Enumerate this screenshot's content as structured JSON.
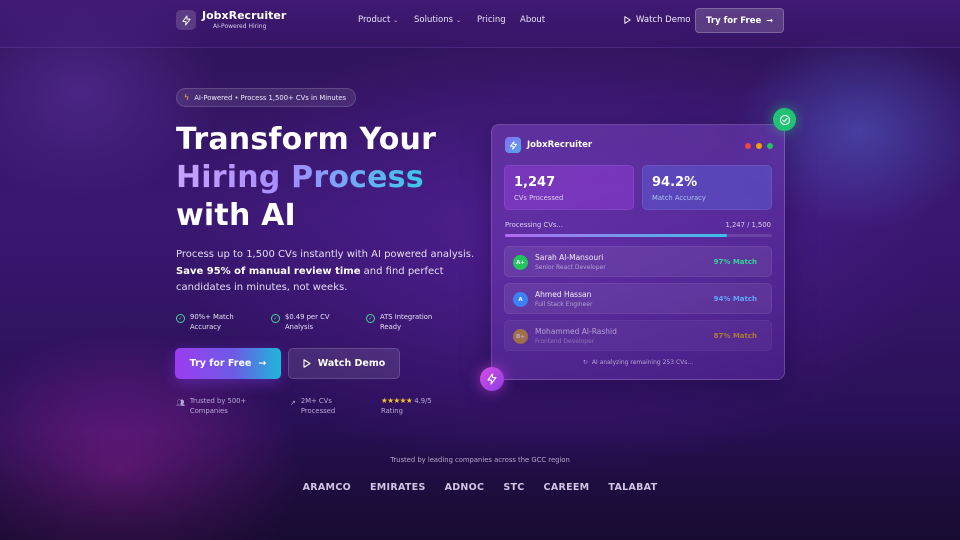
{
  "nav": {
    "brand": "JobxRecruiter",
    "brand_sub": "AI-Powered Hiring",
    "links": [
      {
        "label": "Product",
        "has_dropdown": true
      },
      {
        "label": "Solutions",
        "has_dropdown": true
      },
      {
        "label": "Pricing",
        "has_dropdown": false
      },
      {
        "label": "About",
        "has_dropdown": false
      }
    ],
    "watch_demo": "Watch Demo",
    "cta": "Try for Free"
  },
  "hero": {
    "badge": "AI-Powered • Process 1,500+ CVs in Minutes",
    "title_line1": "Transform Your",
    "title_line2": "Hiring Process",
    "title_line3": "with AI",
    "lead_start": "Process up to 1,500 CVs instantly with AI powered analysis. ",
    "lead_bold": "Save 95% of manual review time",
    "lead_end": " and find perfect candidates in minutes, not weeks.",
    "features": [
      {
        "line1": "90%+ Match",
        "line2": "Accuracy"
      },
      {
        "line1": "$0.49 per CV",
        "line2": "Analysis"
      },
      {
        "line1": "ATS Integration",
        "line2": "Ready"
      }
    ],
    "primary_button": "Try for Free",
    "secondary_button": "Watch Demo",
    "stats": [
      {
        "icon": "users-icon",
        "line1": "Trusted by 500+",
        "line2": "Companies"
      },
      {
        "icon": "trending-up-icon",
        "line1": "2M+ CVs",
        "line2": "Processed"
      },
      {
        "icon": "star-icon",
        "line1": "4.9/5",
        "line2": "Rating",
        "stars": "★★★★★"
      }
    ]
  },
  "dashboard": {
    "title": "JobxRecruiter",
    "window_dots": [
      "#ef4444",
      "#f59e0b",
      "#22c55e"
    ],
    "kpis": [
      {
        "value": "1,247",
        "label": "CVs Processed"
      },
      {
        "value": "94.2%",
        "label": "Match Accuracy"
      }
    ],
    "progress": {
      "label": "Processing CVs...",
      "count": "1,247 / 1,500",
      "fraction": 0.831
    },
    "candidates": [
      {
        "initials": "A+",
        "name": "Sarah Al-Mansouri",
        "role": "Senior React Developer",
        "match": "97% Match",
        "avatar_color": "#22c55e",
        "match_color": "#34d399"
      },
      {
        "initials": "A",
        "name": "Ahmed Hassan",
        "role": "Full Stack Engineer",
        "match": "94% Match",
        "avatar_color": "#3b82f6",
        "match_color": "#60a5fa"
      },
      {
        "initials": "B+",
        "name": "Mohammed Al-Rashid",
        "role": "Frontend Developer",
        "match": "87% Match",
        "avatar_color": "#d4a017",
        "match_color": "#eab308"
      }
    ],
    "ai_note": "AI analyzing remaining 253 CVs..."
  },
  "trusted": {
    "caption": "Trusted by leading companies across the GCC region",
    "companies": [
      "ARAMCO",
      "EMIRATES",
      "ADNOC",
      "STC",
      "CAREEM",
      "TALABAT"
    ]
  }
}
